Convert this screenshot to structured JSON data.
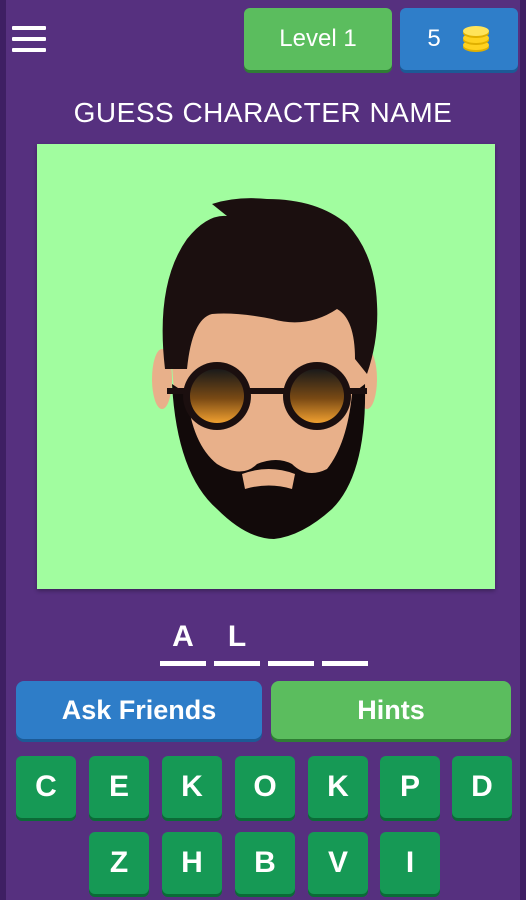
{
  "header": {
    "menu_icon": "hamburger-menu-icon",
    "level_label": "Level 1",
    "coins": "5",
    "coin_icon": "coin-stack-icon"
  },
  "title": "GUESS CHARACTER NAME",
  "puzzle": {
    "image": "bearded-man-with-round-sunglasses",
    "answer_slots": [
      "A",
      "L",
      "",
      ""
    ]
  },
  "actions": {
    "ask_friends": "Ask Friends",
    "hints": "Hints"
  },
  "keyboard": {
    "row1": [
      "C",
      "E",
      "K",
      "O",
      "K",
      "P",
      "D"
    ],
    "row2": [
      "Z",
      "H",
      "B",
      "V",
      "I"
    ]
  },
  "colors": {
    "background": "#56307f",
    "green_button": "#5bbd5e",
    "blue_button": "#2e7dc8",
    "key_green": "#169955",
    "picture_bg": "#a1fd9f"
  }
}
